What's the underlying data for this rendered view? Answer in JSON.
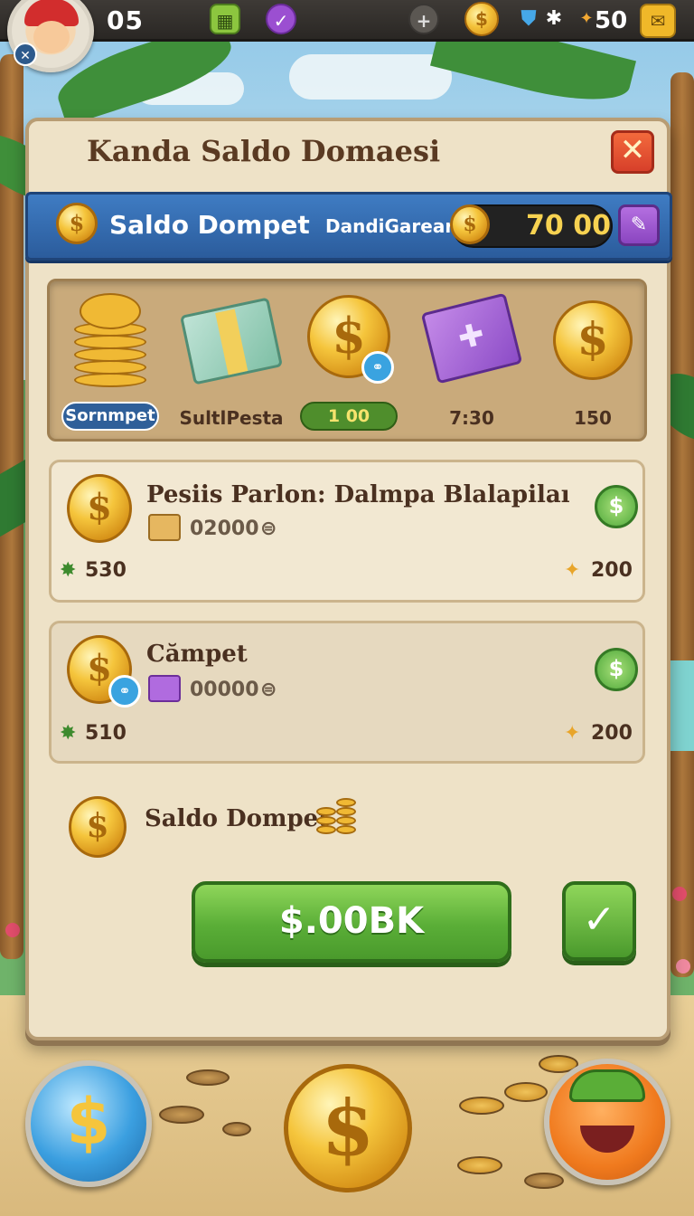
{
  "hud": {
    "level": "05",
    "stat_value": "50"
  },
  "panel": {
    "title": "Kanda Saldo Domaesi",
    "close_symbol": "✕"
  },
  "balance": {
    "label": "Saldo Dompet",
    "username": "DandiGareart",
    "value": "70 00"
  },
  "shelf": {
    "items": [
      {
        "label": "Sornmpet",
        "icon": "coin-stack-icon"
      },
      {
        "label": "SultlPesta",
        "icon": "cash-bundle-icon"
      },
      {
        "label": "1 00",
        "icon": "gold-coin-icon"
      },
      {
        "label": "7:30",
        "icon": "purple-gift-icon"
      },
      {
        "label": "150",
        "icon": "gold-coin-icon"
      }
    ]
  },
  "offers": [
    {
      "title": "Pesiis Parlon: Dalmpa Blalapilaı",
      "amount": "02000",
      "left_stat": "530",
      "right_stat": "200"
    },
    {
      "title": "Cămpet",
      "amount": "00000",
      "left_stat": "510",
      "right_stat": "200"
    },
    {
      "title": "Saldo Dompet"
    }
  ],
  "actions": {
    "buy_label": "$.00BK",
    "confirm_symbol": "✓"
  },
  "colors": {
    "panel_bg": "#eee2c7",
    "balance_bar": "#3f7cc3",
    "buy_button": "#5aae37",
    "close_button": "#d7402a",
    "gold": "#f5c53c"
  }
}
